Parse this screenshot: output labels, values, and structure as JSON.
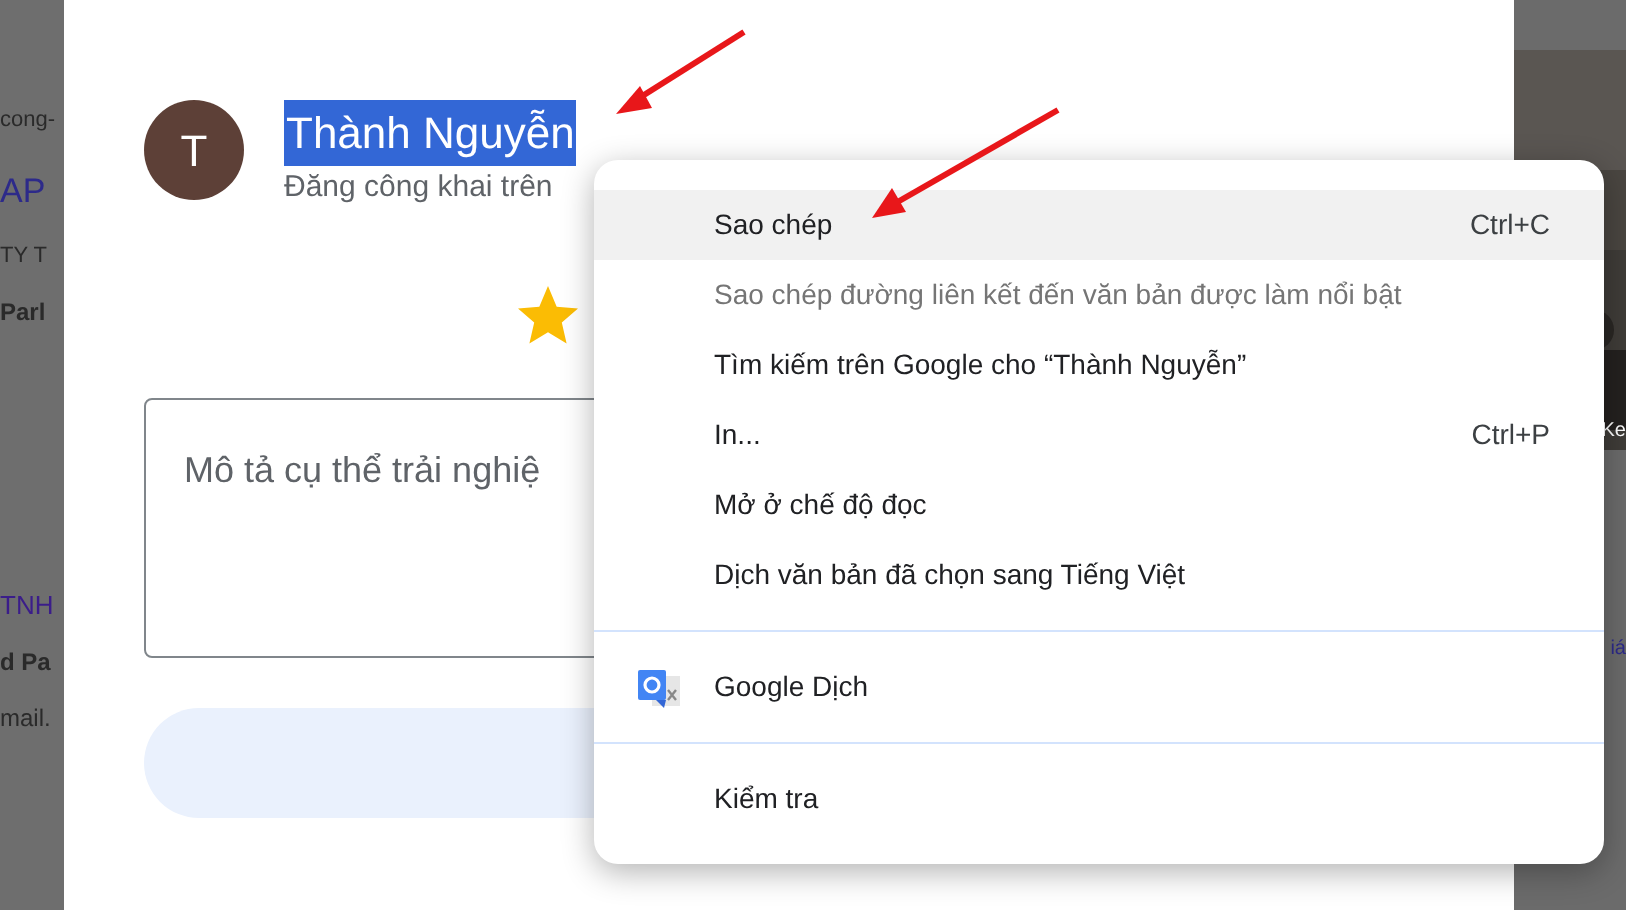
{
  "background_left": [
    "cong-",
    "AP",
    "TY T",
    "Parl",
    "TNH",
    "d Pa",
    "mail."
  ],
  "background_right": {
    "photo_caption": "Ke",
    "link": "iá"
  },
  "dialog": {
    "avatar_letter": "T",
    "author": "Thành Nguyễn",
    "author_selected": true,
    "subtitle": "Đăng công khai trên",
    "review_box": {
      "placeholder": "Mô tả cụ thể trải nghiệ"
    }
  },
  "context_menu": {
    "groups": [
      [
        {
          "label": "Sao chép",
          "shortcut": "Ctrl+C",
          "selected": true,
          "disabled": false
        },
        {
          "label": "Sao chép đường liên kết đến văn bản được làm nổi bật",
          "selected": false,
          "disabled": true
        },
        {
          "label": "Tìm kiếm trên Google cho “Thành Nguyễn”",
          "selected": false,
          "disabled": false
        },
        {
          "label": "In...",
          "shortcut": "Ctrl+P",
          "selected": false,
          "disabled": false
        },
        {
          "label": "Mở ở chế độ đọc",
          "selected": false,
          "disabled": false
        },
        {
          "label": "Dịch văn bản đã chọn sang Tiếng Việt",
          "selected": false,
          "disabled": false
        }
      ],
      [
        {
          "label": "Google Dịch",
          "kind": "translate",
          "selected": false,
          "disabled": false
        }
      ],
      [
        {
          "label": "Kiểm tra",
          "selected": false,
          "disabled": false
        }
      ]
    ]
  }
}
